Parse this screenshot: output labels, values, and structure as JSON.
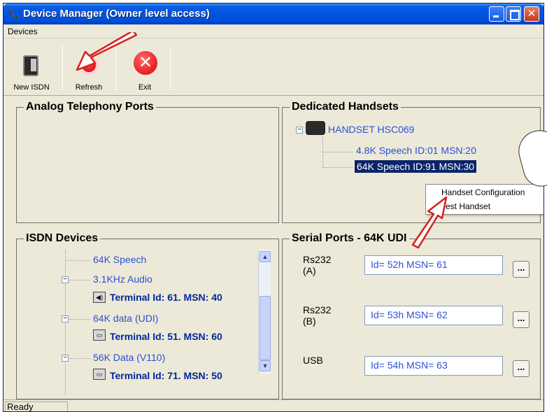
{
  "window": {
    "title": "Device Manager (Owner level access)",
    "icon": "device-manager-icon"
  },
  "menubar": {
    "items": [
      "Devices"
    ]
  },
  "toolbar": {
    "buttons": [
      {
        "label": "New ISDN",
        "icon": "phone-icon"
      },
      {
        "label": "Refresh",
        "icon": "refresh-icon"
      },
      {
        "label": "Exit",
        "icon": "exit-icon"
      }
    ]
  },
  "analog": {
    "title": "Analog Telephony Ports"
  },
  "dedicated": {
    "title": "Dedicated Handsets",
    "root": "HANDSET HSC069",
    "children": [
      "4.8K Speech ID:01 MSN:20",
      "64K Speech ID:91 MSN:30"
    ],
    "selected_index": 1
  },
  "context_menu": {
    "items": [
      "Handset Configuration",
      "Test Handset"
    ]
  },
  "isdn": {
    "title": "ISDN Devices",
    "items": [
      {
        "text": "64K Speech",
        "type": "service"
      },
      {
        "text": "3.1KHz Audio",
        "type": "service"
      },
      {
        "text": "Terminal Id: 61.  MSN: 40",
        "type": "terminal"
      },
      {
        "text": "64K data (UDI)",
        "type": "service"
      },
      {
        "text": "Terminal Id: 51.  MSN: 60",
        "type": "terminal"
      },
      {
        "text": "56K Data (V110)",
        "type": "service"
      },
      {
        "text": "Terminal Id: 71.  MSN: 50",
        "type": "terminal"
      }
    ]
  },
  "serial": {
    "title": "Serial Ports - 64K UDI",
    "ports": [
      {
        "label_line1": "Rs232",
        "label_line2": "(A)",
        "value": "Id= 52h  MSN= 61",
        "button": "..."
      },
      {
        "label_line1": "Rs232",
        "label_line2": "(B)",
        "value": "Id= 53h  MSN= 62",
        "button": "..."
      },
      {
        "label_line1": "USB",
        "label_line2": "",
        "value": "Id= 54h  MSN= 63",
        "button": "..."
      }
    ]
  },
  "status": {
    "text": "Ready"
  },
  "colors": {
    "title_bar": "#0054e3",
    "tree_blue": "#2b50d8",
    "terminal_blue": "#00279b",
    "selection": "#0a246a",
    "annotation_arrow": "#d81e1e"
  }
}
